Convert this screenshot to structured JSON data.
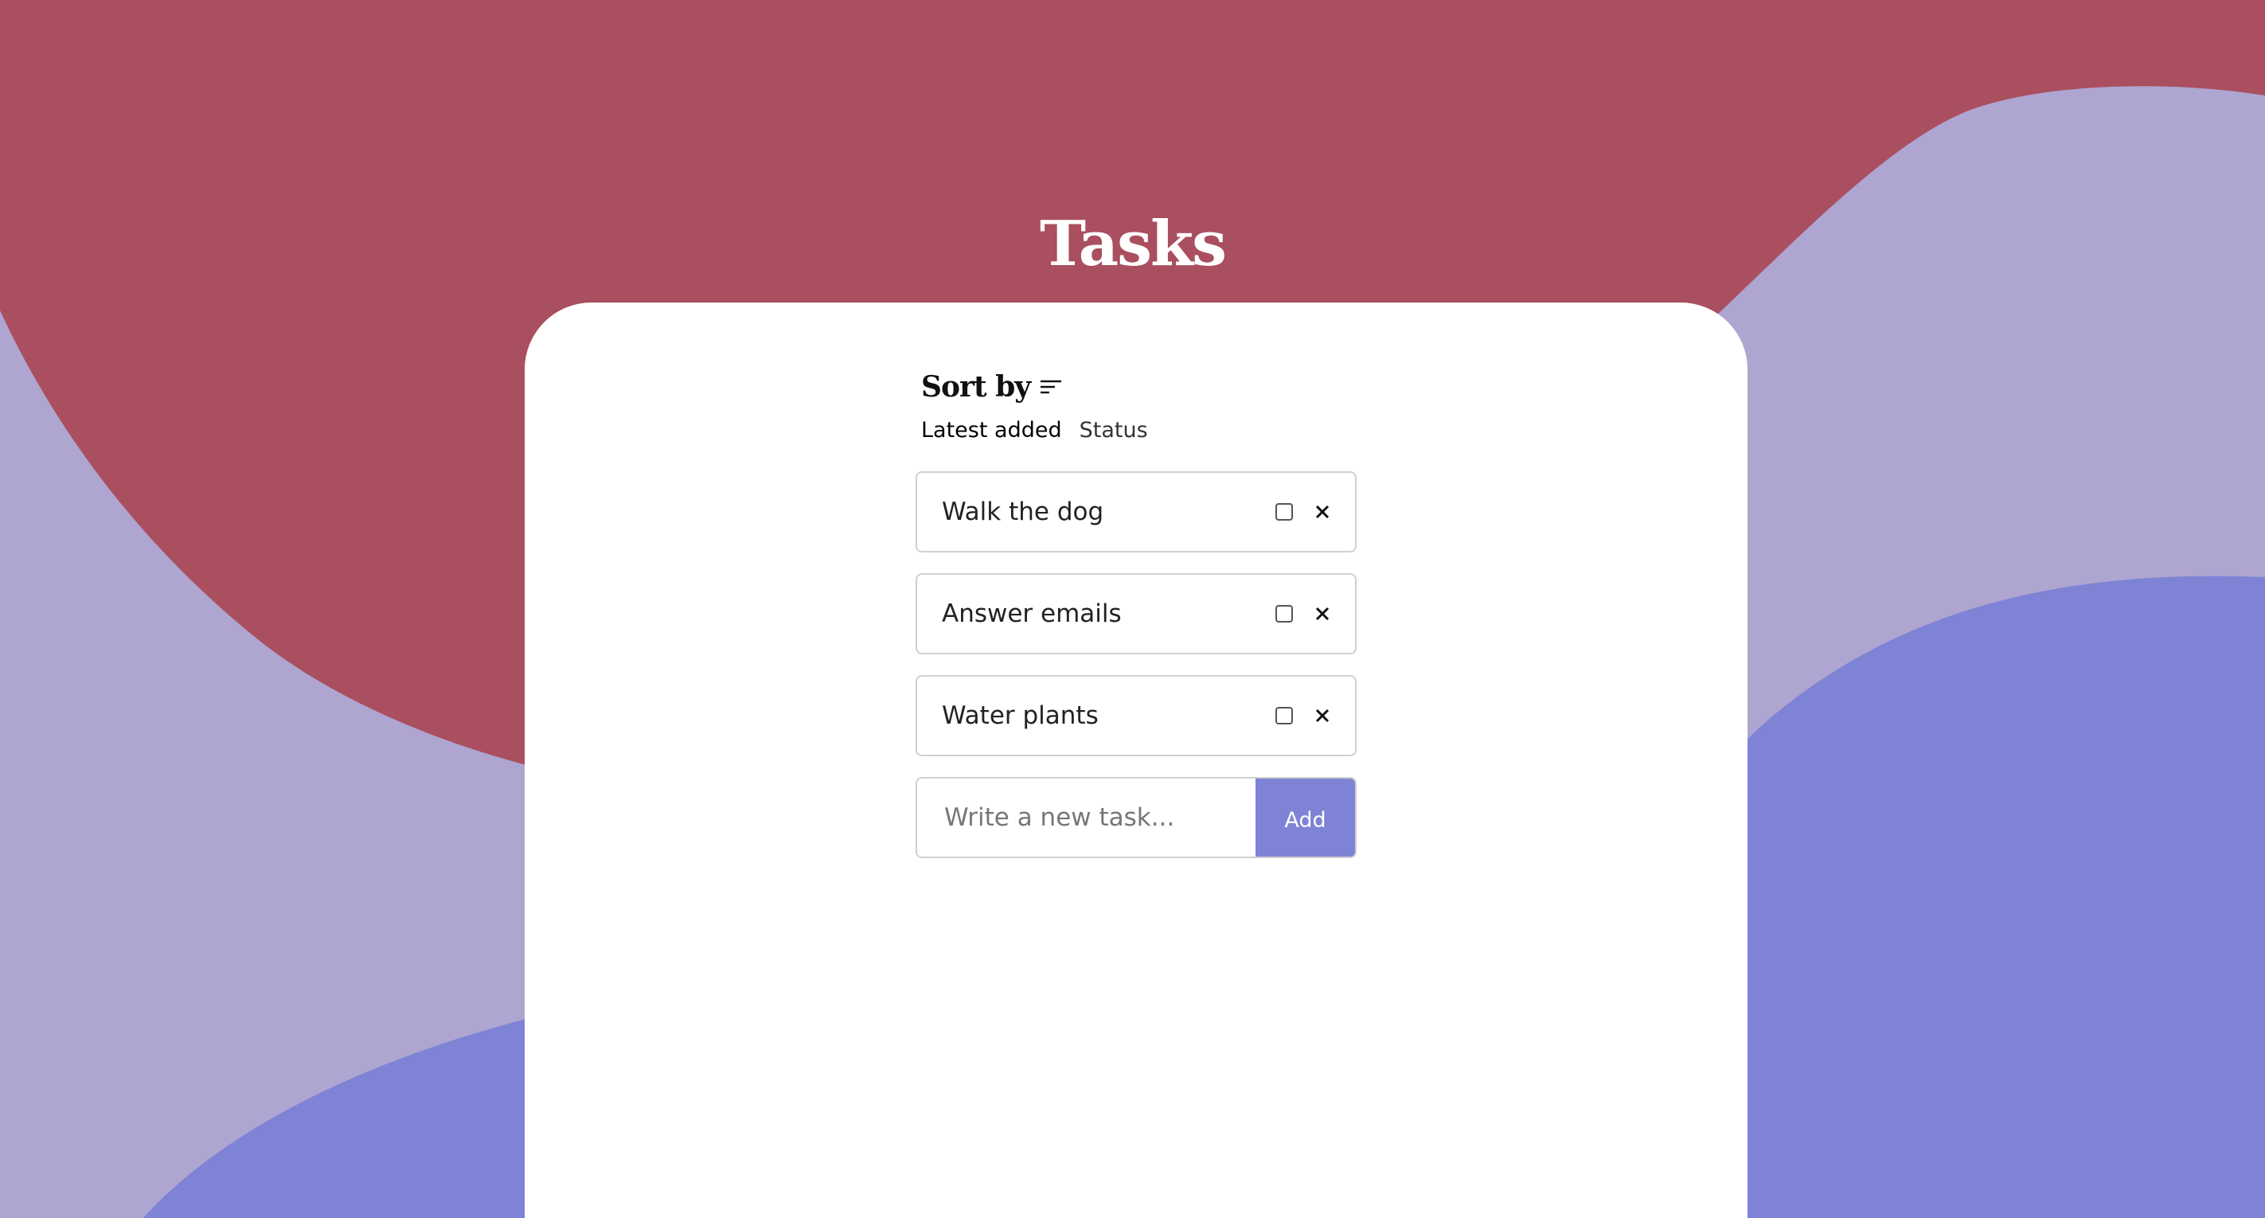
{
  "app": {
    "title": "Tasks"
  },
  "colors": {
    "background_lavender": "#aea5d0",
    "wave_red": "#a94f5f",
    "wave_blue": "#7e83d5",
    "card": "#ffffff",
    "accent": "#7e83d5"
  },
  "sort": {
    "heading": "Sort by",
    "icon": "sort-lines-icon",
    "options": [
      {
        "label": "Latest added",
        "active": true
      },
      {
        "label": "Status",
        "active": false
      }
    ]
  },
  "tasks": [
    {
      "label": "Walk the dog",
      "done": false
    },
    {
      "label": "Answer emails",
      "done": false
    },
    {
      "label": "Water plants",
      "done": false
    }
  ],
  "new_task": {
    "value": "",
    "placeholder": "Write a new task...",
    "add_label": "Add"
  }
}
